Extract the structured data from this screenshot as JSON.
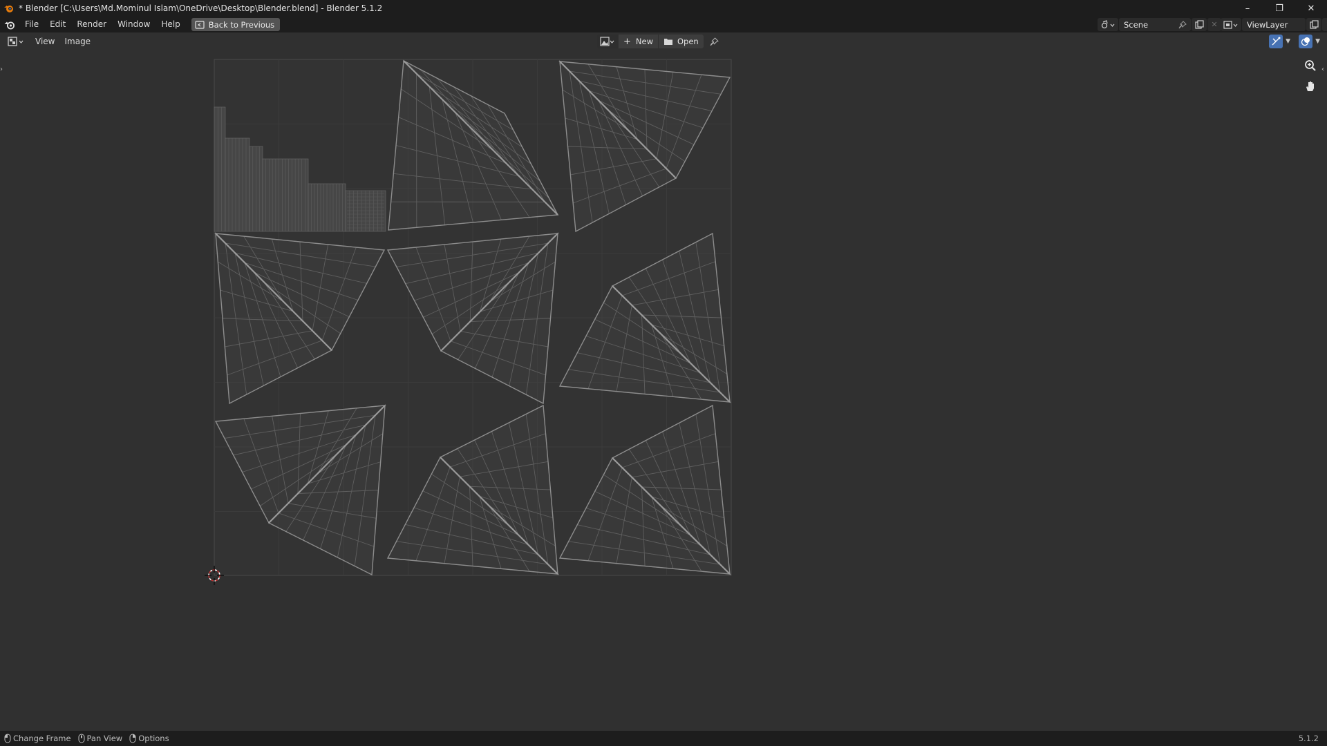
{
  "window": {
    "title": "* Blender [C:\\Users\\Md.Mominul Islam\\OneDrive\\Desktop\\Blender.blend] - Blender 5.1.2",
    "minimize": "–",
    "maximize": "❐",
    "close": "✕"
  },
  "menu": {
    "file": "File",
    "edit": "Edit",
    "render": "Render",
    "window": "Window",
    "help": "Help",
    "back_to_previous": "Back to Previous"
  },
  "scene": {
    "label": "Scene"
  },
  "view_layer": {
    "label": "ViewLayer"
  },
  "editor_header": {
    "view": "View",
    "image": "Image",
    "new": "New",
    "open": "Open"
  },
  "status_bar": {
    "change_frame": "Change Frame",
    "pan_view": "Pan View",
    "options": "Options",
    "version": "5.1.2"
  },
  "colors": {
    "background": "#303030",
    "bar": "#1d1d1d",
    "uv_wire": "#8c8c8c",
    "cursor": "#c03030"
  }
}
